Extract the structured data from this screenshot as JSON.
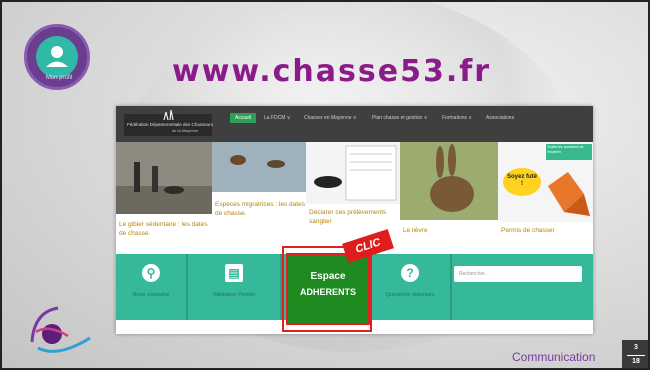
{
  "slide": {
    "user_badge_caption": "Mon profil",
    "site_title": "www.chasse53.fr",
    "footer_label": "Communication",
    "page_current": "3",
    "page_total": "18"
  },
  "website": {
    "logo_line1": "Fédération Départementale des Chasseurs",
    "logo_line2": "de la Mayenne",
    "nav": [
      {
        "label": "Accueil"
      },
      {
        "label": "La FDCM ∨"
      },
      {
        "label": "Chasser en Mayenne ∨"
      },
      {
        "label": "Plan chasse et gestion ∨"
      },
      {
        "label": "Formations ∨"
      },
      {
        "label": "Associations"
      }
    ],
    "tiles": [
      {
        "caption": "Le gibier sédentaire : les dates de chasse."
      },
      {
        "caption": "Espèces migratrices : les dates de chasse."
      },
      {
        "caption": "Déclarer ces prélèvements sanglier"
      },
      {
        "caption": "Le lièvre"
      },
      {
        "caption": "Permis de chasser",
        "badge": "Toutes les questions de l'examen",
        "bubble": "Soyez futé !"
      }
    ],
    "bottom": [
      {
        "label": "Nous connaitre",
        "icon": "location-pin-icon"
      },
      {
        "label": "Validation Permis",
        "icon": "document-icon"
      },
      {
        "label": "Questions réponses",
        "icon": "question-icon"
      }
    ],
    "search_placeholder": "Rechercher...",
    "espace_line1": "Espace",
    "espace_line2": "ADHERENTS",
    "clic_flag": "CLIC"
  }
}
